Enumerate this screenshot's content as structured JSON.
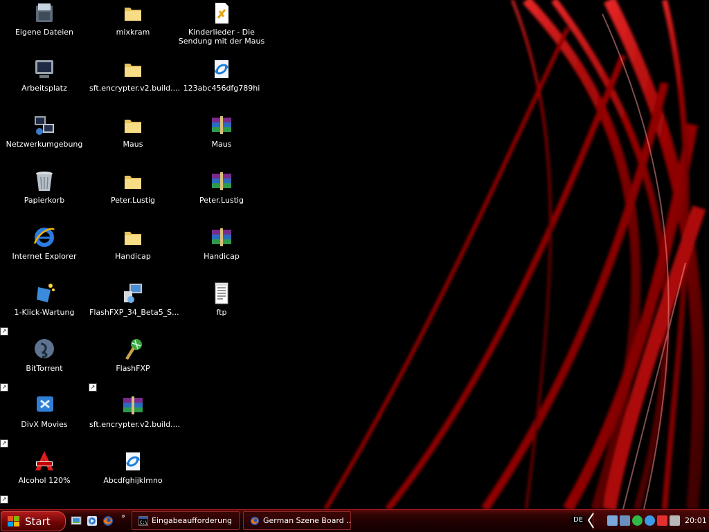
{
  "desktop": {
    "icons": [
      {
        "label": "Eigene Dateien",
        "icon": "my-documents-icon"
      },
      {
        "label": "Arbeitsplatz",
        "icon": "my-computer-icon"
      },
      {
        "label": "Netzwerkumgebung",
        "icon": "network-places-icon"
      },
      {
        "label": "Papierkorb",
        "icon": "recycle-bin-icon"
      },
      {
        "label": "Internet Explorer",
        "icon": "internet-explorer-icon"
      },
      {
        "label": "1-Klick-Wartung",
        "icon": "maintenance-icon"
      },
      {
        "label": "BitTorrent",
        "icon": "bittorrent-icon"
      },
      {
        "label": "DivX Movies",
        "icon": "divx-icon"
      },
      {
        "label": "Alcohol 120%",
        "icon": "alcohol-icon"
      },
      {
        "label": "mixkram",
        "icon": "folder-icon"
      },
      {
        "label": "sft.encrypter.v2.build....",
        "icon": "folder-icon"
      },
      {
        "label": "Maus",
        "icon": "folder-icon"
      },
      {
        "label": "Peter.Lustig",
        "icon": "folder-icon"
      },
      {
        "label": "Handicap",
        "icon": "folder-icon"
      },
      {
        "label": "FlashFXP_34_Beta5_S...",
        "icon": "installer-icon"
      },
      {
        "label": "FlashFXP",
        "icon": "flashfxp-icon"
      },
      {
        "label": "sft.encrypter.v2.build....",
        "icon": "winrar-archive-icon"
      },
      {
        "label": "Abcdfghijklmno",
        "icon": "file-sync-icon"
      },
      {
        "label": "Kinderlieder - Die Sendung mit der Maus",
        "icon": "file-link-icon"
      },
      {
        "label": "123abc456dfg789hi",
        "icon": "file-sync-icon"
      },
      {
        "label": "Maus",
        "icon": "winrar-archive-icon"
      },
      {
        "label": "Peter.Lustig",
        "icon": "winrar-archive-icon"
      },
      {
        "label": "Handicap",
        "icon": "winrar-archive-icon"
      },
      {
        "label": "ftp",
        "icon": "text-file-icon"
      }
    ]
  },
  "taskbar": {
    "start_label": "Start",
    "quick_launch": [
      "show-desktop-icon",
      "media-player-icon",
      "firefox-icon"
    ],
    "tasks": [
      {
        "label": "Eingabeaufforderung",
        "icon": "command-prompt-icon"
      },
      {
        "label": "German Szene Board ...",
        "icon": "firefox-icon"
      }
    ],
    "language": "DE",
    "clock": "20:01"
  }
}
